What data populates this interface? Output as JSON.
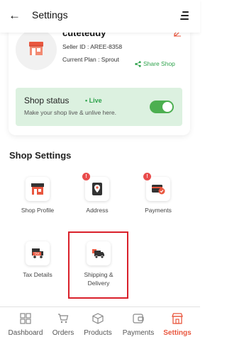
{
  "header": {
    "title": "Settings",
    "back_icon": "arrow-left-icon",
    "menu_icon": "hamburger-icon"
  },
  "shop": {
    "name": "cuteteddy",
    "seller_id": "Seller ID : AREE-8358",
    "plan": "Current Plan : Sprout",
    "share_label": "Share Shop",
    "status_title": "Shop status",
    "status_live": "Live",
    "status_sub": "Make your shop live & unlive here.",
    "status_on": true
  },
  "section_title": "Shop Settings",
  "tiles": [
    {
      "label": "Shop Profile",
      "icon": "shop-icon",
      "badge": false
    },
    {
      "label": "Address",
      "icon": "location-pin-icon",
      "badge": true
    },
    {
      "label": "Payments",
      "icon": "wallet-card-icon",
      "badge": true
    },
    {
      "label": "Tax Details",
      "icon": "tax-truck-icon",
      "badge": false
    },
    {
      "label": "Shipping & Delivery",
      "icon": "delivery-truck-icon",
      "badge": false
    }
  ],
  "badge_text": "!",
  "bottom_nav": [
    {
      "label": "Dashboard",
      "icon": "grid-icon",
      "active": false
    },
    {
      "label": "Orders",
      "icon": "cart-icon",
      "active": false
    },
    {
      "label": "Products",
      "icon": "box-icon",
      "active": false
    },
    {
      "label": "Payments",
      "icon": "payments-icon",
      "active": false
    },
    {
      "label": "Settings",
      "icon": "store-icon",
      "active": true
    }
  ],
  "colors": {
    "accent": "#e9573f",
    "green": "#2da24b",
    "status_bg": "#dcf1e0",
    "highlight": "#d9202a"
  }
}
